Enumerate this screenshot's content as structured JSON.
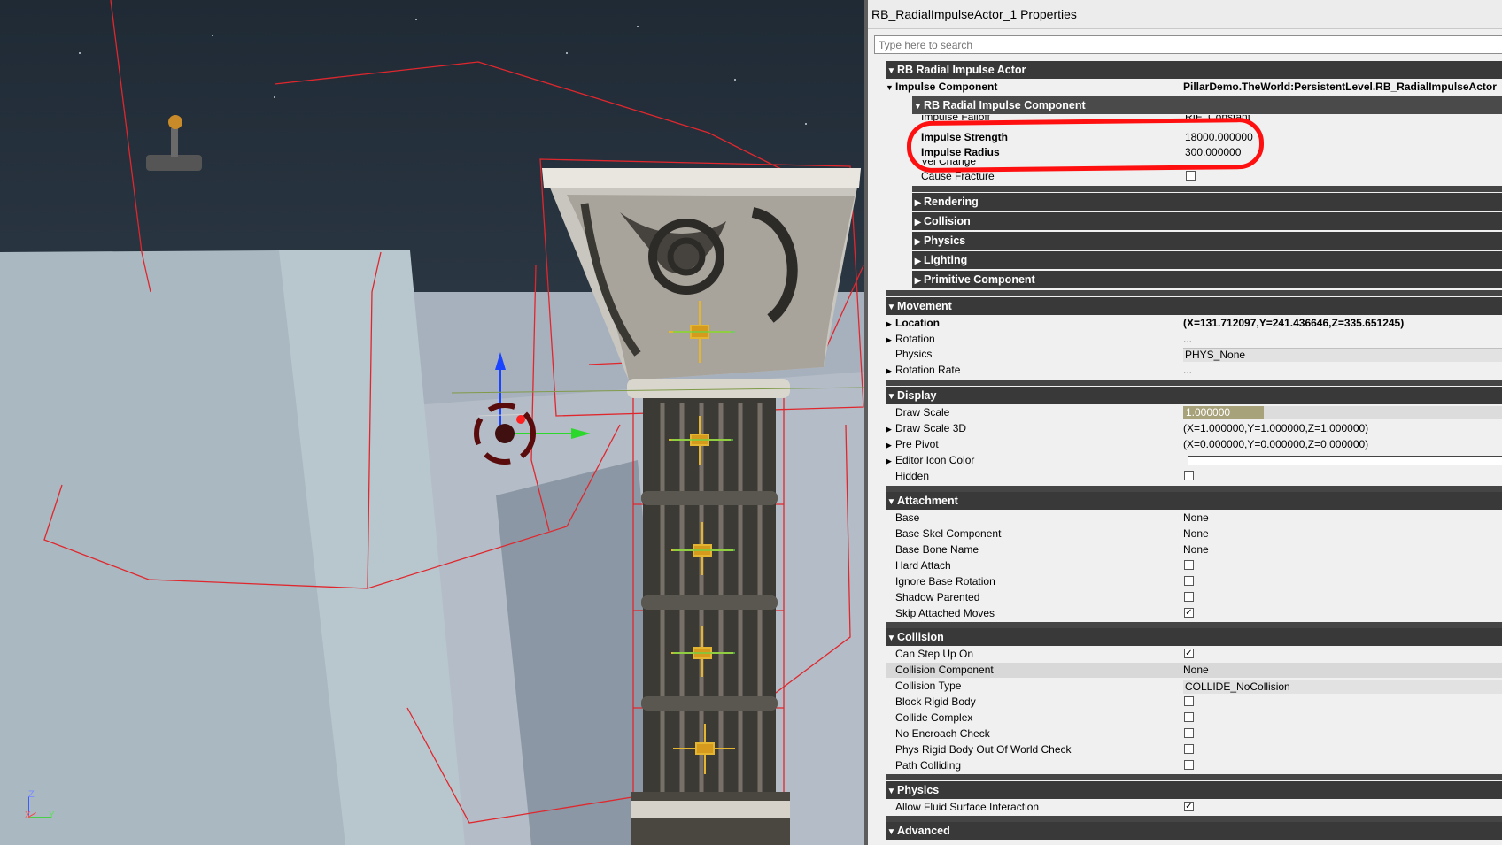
{
  "window_title": "RB_RadialImpulseActor_1 Properties",
  "search_placeholder": "Type here to search",
  "viewport": {
    "axes": {
      "z": "Z",
      "x": "X",
      "y": "Y"
    }
  },
  "colors": {
    "category_bar": "#393939",
    "highlight_circle": "#ff1010",
    "panel_bg": "#f0f0f0",
    "draw_scale_fill": "#a8a27a"
  },
  "icons": {
    "expanded": "triangle-down",
    "collapsed": "triangle-right",
    "checkbox": "checkbox"
  },
  "tree": {
    "rb_radial_impulse_actor": "RB Radial Impulse Actor",
    "impulse_component": {
      "label": "Impulse Component",
      "value": "PillarDemo.TheWorld:PersistentLevel.RB_RadialImpulseActor"
    },
    "rb_radial_impulse_component": "RB Radial Impulse Component",
    "impulse_falloff": {
      "label": "Impulse Falloff",
      "value": "RIF_Constant"
    },
    "impulse_strength": {
      "label": "Impulse Strength",
      "value": "18000.000000"
    },
    "impulse_radius": {
      "label": "Impulse Radius",
      "value": "300.000000"
    },
    "vel_change": {
      "label": "Vel Change",
      "checked": false
    },
    "cause_fracture": {
      "label": "Cause Fracture",
      "checked": false
    },
    "sub_categories": [
      "Rendering",
      "Collision",
      "Physics",
      "Lighting",
      "Primitive Component"
    ],
    "movement": {
      "title": "Movement",
      "location": {
        "label": "Location",
        "value": "(X=131.712097,Y=241.436646,Z=335.651245)"
      },
      "rotation": {
        "label": "Rotation",
        "value": "..."
      },
      "physics": {
        "label": "Physics",
        "value": "PHYS_None"
      },
      "rotation_rate": {
        "label": "Rotation Rate",
        "value": "..."
      }
    },
    "display": {
      "title": "Display",
      "draw_scale": {
        "label": "Draw Scale",
        "value": "1.000000",
        "fill_fraction": 0.25
      },
      "draw_scale_3d": {
        "label": "Draw Scale 3D",
        "value": "(X=1.000000,Y=1.000000,Z=1.000000)"
      },
      "pre_pivot": {
        "label": "Pre Pivot",
        "value": "(X=0.000000,Y=0.000000,Z=0.000000)"
      },
      "editor_icon_color": {
        "label": "Editor Icon Color"
      },
      "hidden": {
        "label": "Hidden",
        "checked": false
      }
    },
    "attachment": {
      "title": "Attachment",
      "base": {
        "label": "Base",
        "value": "None"
      },
      "base_skel_component": {
        "label": "Base Skel Component",
        "value": "None"
      },
      "base_bone_name": {
        "label": "Base Bone Name",
        "value": "None"
      },
      "hard_attach": {
        "label": "Hard Attach",
        "checked": false
      },
      "ignore_base_rotation": {
        "label": "Ignore Base Rotation",
        "checked": false
      },
      "shadow_parented": {
        "label": "Shadow Parented",
        "checked": false
      },
      "skip_attached_moves": {
        "label": "Skip Attached Moves",
        "checked": true
      }
    },
    "collision": {
      "title": "Collision",
      "can_step_up_on": {
        "label": "Can Step Up On",
        "checked": true
      },
      "collision_component": {
        "label": "Collision Component",
        "value": "None"
      },
      "collision_type": {
        "label": "Collision Type",
        "value": "COLLIDE_NoCollision"
      },
      "block_rigid_body": {
        "label": "Block Rigid Body",
        "checked": false
      },
      "collide_complex": {
        "label": "Collide Complex",
        "checked": false
      },
      "no_encroach_check": {
        "label": "No Encroach Check",
        "checked": false
      },
      "phys_rigid_body_out_of_world_check": {
        "label": "Phys Rigid Body Out Of World Check",
        "checked": false
      },
      "path_colliding": {
        "label": "Path Colliding",
        "checked": false
      }
    },
    "physics": {
      "title": "Physics",
      "allow_fluid_surface_interaction": {
        "label": "Allow Fluid Surface Interaction",
        "checked": true
      }
    },
    "advanced": {
      "title": "Advanced"
    }
  }
}
